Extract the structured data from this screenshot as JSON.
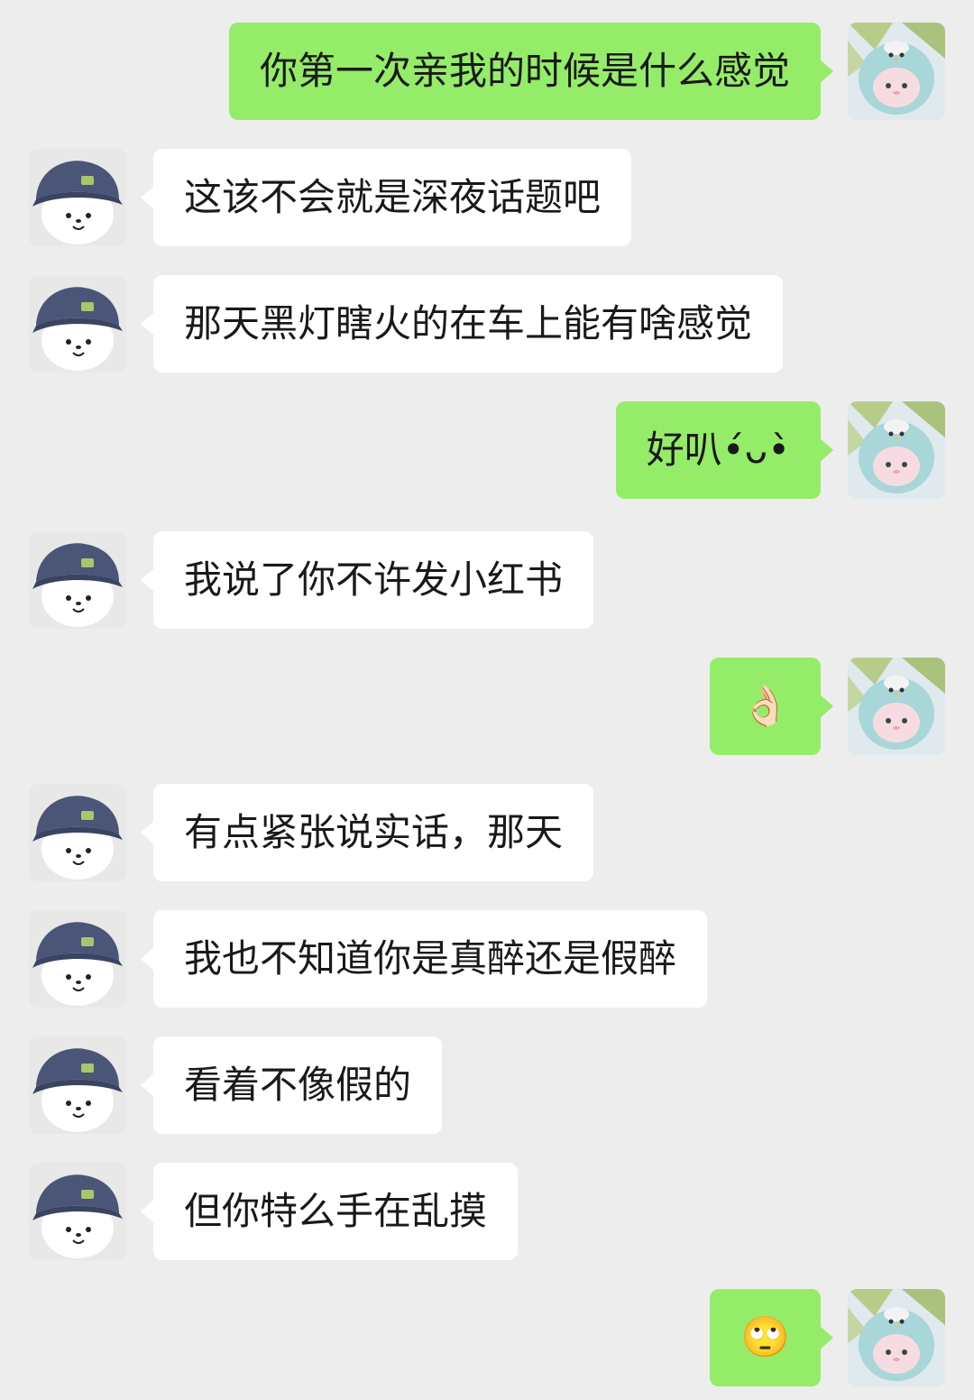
{
  "conversation": {
    "messages": [
      {
        "side": "out",
        "text": "你第一次亲我的时候是什么感觉"
      },
      {
        "side": "in",
        "text": "这该不会就是深夜话题吧"
      },
      {
        "side": "in",
        "text": "那天黑灯瞎火的在车上能有啥感觉"
      },
      {
        "side": "out",
        "text": "好叭•́ᴗ•̀"
      },
      {
        "side": "in",
        "text": "我说了你不许发小红书"
      },
      {
        "side": "out",
        "text": "👌🏻"
      },
      {
        "side": "in",
        "text": "有点紧张说实话，那天"
      },
      {
        "side": "in",
        "text": "我也不知道你是真醉还是假醉"
      },
      {
        "side": "in",
        "text": "看着不像假的"
      },
      {
        "side": "in",
        "text": "但你特么手在乱摸"
      },
      {
        "side": "out",
        "text": "🙄"
      }
    ]
  },
  "avatars": {
    "me": "penguin-plush-avatar",
    "contact": "bear-with-hat-avatar"
  },
  "colors": {
    "background": "#ededed",
    "outgoing_bubble": "#95ec69",
    "incoming_bubble": "#ffffff",
    "text": "#191919"
  }
}
